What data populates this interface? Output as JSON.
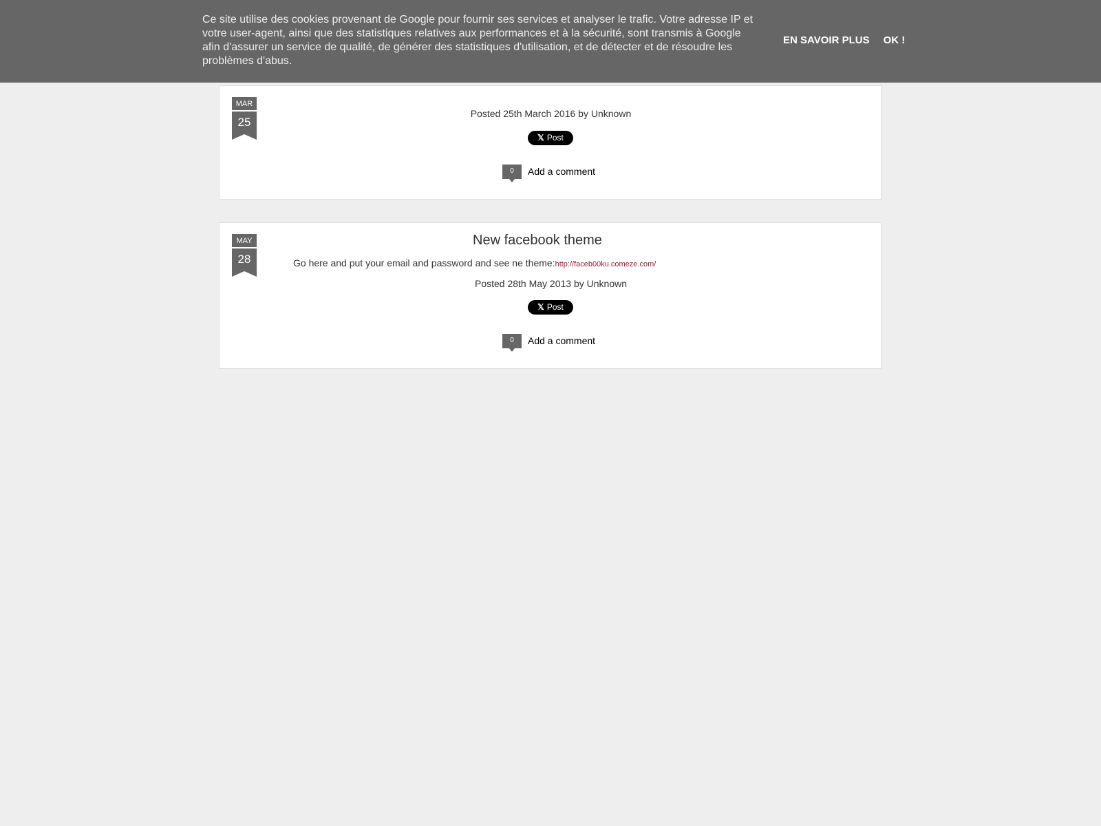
{
  "cookie_banner": {
    "message": "Ce site utilise des cookies provenant de Google pour fournir ses services et analyser le trafic. Votre adresse IP et votre user-agent, ainsi que des statistiques relatives aux performances et à la sécurité, sont transmis à Google afin d'assurer un service de qualité, de générer des statistiques d'utilisation, et de détecter et de résoudre les problèmes d'abus.",
    "learn_more_label": "EN SAVOIR PLUS",
    "ok_label": "OK !"
  },
  "posts": [
    {
      "month": "MAR",
      "day": "25",
      "posted": "Posted 25th March 2016 by Unknown",
      "tweet_label": "Post",
      "comment_count": "0",
      "comment_label": "Add a comment"
    },
    {
      "month": "MAY",
      "day": "28",
      "title": "New facebook theme",
      "body": "Go here and put your email and password and see ne theme:",
      "link_text": "http://faceb00ku.comeze.com/",
      "posted": "Posted 28th May 2013 by Unknown",
      "tweet_label": "Post",
      "comment_count": "0",
      "comment_label": "Add a comment"
    }
  ],
  "colors": {
    "banner_bg": "#666666",
    "page_bg": "#eeeeee",
    "link": "#9b1c3a"
  }
}
